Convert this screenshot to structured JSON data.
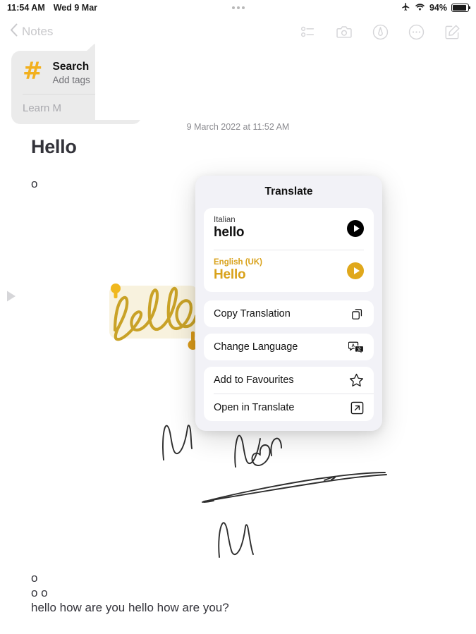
{
  "status_bar": {
    "time": "11:54 AM",
    "date": "Wed 9 Mar",
    "battery_percent": "94%",
    "icons": [
      "airplane-mode-icon",
      "wifi-icon",
      "battery-icon"
    ]
  },
  "nav_bar": {
    "back_label": "Notes",
    "tools": [
      {
        "name": "checklist-icon"
      },
      {
        "name": "camera-icon"
      },
      {
        "name": "markup-pen-icon"
      },
      {
        "name": "more-options-icon"
      },
      {
        "name": "compose-icon"
      }
    ]
  },
  "tag_popup": {
    "hash_symbol": "#",
    "title": "Search",
    "subtitle": "Add tags",
    "learn_more": "Learn M"
  },
  "note": {
    "date": "9 March 2022 at 11:52 AM",
    "title": "Hello",
    "line1": "o",
    "line2": "o",
    "line3": "o o",
    "line4": "hello how are you hello how are you?",
    "handwriting_gold": "hello"
  },
  "sidebar": {
    "expand_icon": "play-triangle-icon"
  },
  "translate_popup": {
    "title": "Translate",
    "source": {
      "language": "Italian",
      "word": "hello",
      "play_icon": "play-button-icon",
      "play_color": "#000000"
    },
    "target": {
      "language": "English (UK)",
      "word": "Hello",
      "play_icon": "play-button-icon",
      "play_color": "#e0a81c"
    },
    "menu": [
      {
        "label": "Copy Translation",
        "icon": "copy-icon"
      },
      {
        "label": "Change Language",
        "icon": "change-language-icon"
      },
      {
        "label": "Add to Favourites",
        "icon": "star-icon"
      },
      {
        "label": "Open in Translate",
        "icon": "open-external-icon"
      }
    ]
  },
  "colors": {
    "accent_gold": "#d9a21b",
    "tag_yellow": "#f2b01e",
    "popup_bg": "#f2f2f7",
    "card_bg": "#ffffff",
    "text_primary": "#111111",
    "text_secondary": "#8c8c91"
  }
}
